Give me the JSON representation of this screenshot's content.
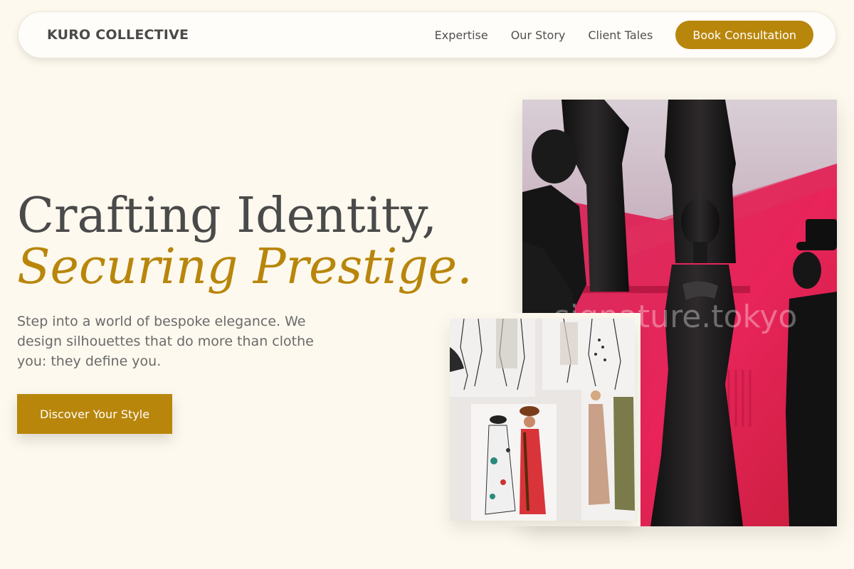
{
  "nav": {
    "brand": "KURO COLLECTIVE",
    "links": [
      "Expertise",
      "Our Story",
      "Client Tales"
    ],
    "cta": "Book Consultation"
  },
  "hero": {
    "headline_line1": "Crafting Identity,",
    "headline_line2": "Securing Prestige.",
    "description": "Step into a world of bespoke elegance. We design silhouettes that do more than clothe you: they define you.",
    "cta": "Discover Your Style"
  },
  "images": {
    "main_watermark": "signature.tokyo",
    "main_subject": "black-dress-mannequins-photo",
    "secondary_subject": "fashion-sketches-photo"
  },
  "colors": {
    "background": "#fdf9ee",
    "accent": "#b8860b",
    "text": "#4a4a4a"
  }
}
